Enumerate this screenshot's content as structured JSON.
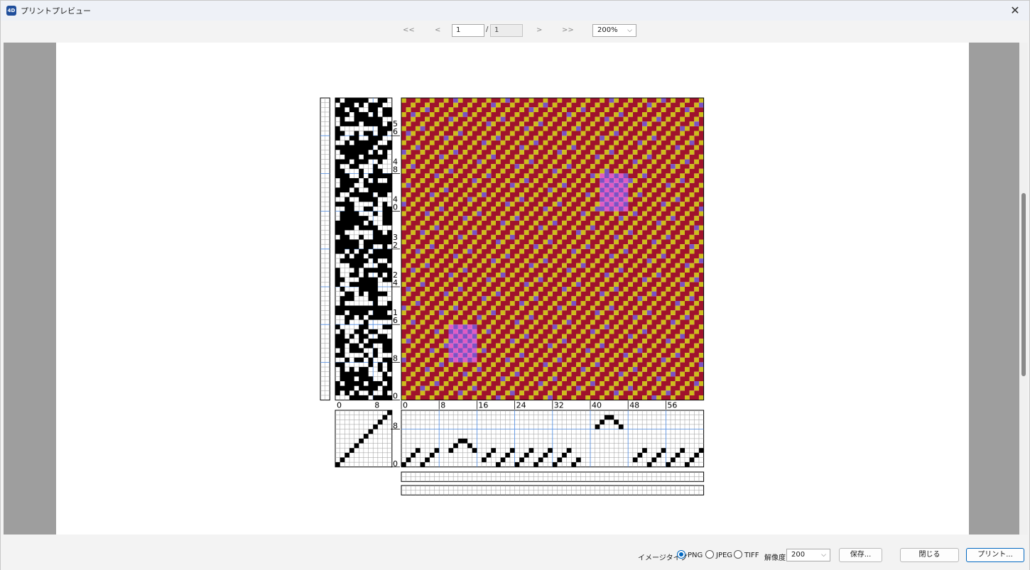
{
  "window": {
    "title": "プリントプレビュー",
    "app_icon": "4D"
  },
  "nav": {
    "first": "<<",
    "prev": "<",
    "next": ">",
    "last": ">>",
    "current_page": "1",
    "slash": "/",
    "total_pages": "1",
    "zoom": "200%"
  },
  "draft": {
    "weft_labels": [
      "56",
      "48",
      "40",
      "32",
      "24",
      "16",
      "8",
      "0"
    ],
    "warp_labels": [
      "0",
      "8",
      "16",
      "24",
      "32",
      "40",
      "48",
      "56"
    ],
    "tieup_x_labels": [
      "0",
      "8"
    ],
    "treadle_labels": [
      "8",
      "0"
    ],
    "colors": {
      "red": "#a0132c",
      "yellow": "#cdbd1a",
      "violet": "#7b52c4",
      "pink": "#e05cc4",
      "black": "#000000",
      "blue_grid": "#4f8ee6"
    }
  },
  "footer": {
    "image_type_label": "イメージタイプ",
    "options": [
      {
        "label": "PNG",
        "selected": true
      },
      {
        "label": "JPEG",
        "selected": false
      },
      {
        "label": "TIFF",
        "selected": false
      }
    ],
    "resolution_label": "解像度",
    "resolution_value": "200",
    "save": "保存...",
    "close": "閉じる",
    "print": "プリント..."
  }
}
